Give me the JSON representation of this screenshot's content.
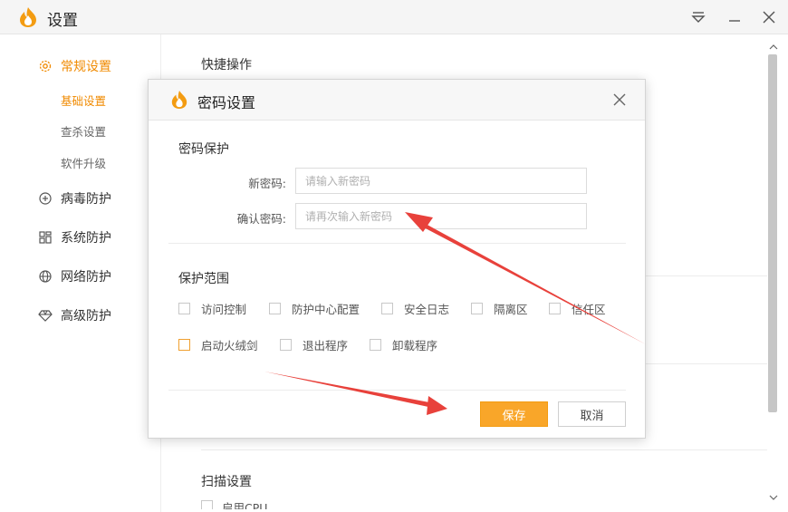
{
  "window": {
    "title": "设置"
  },
  "sidebar": {
    "items": [
      {
        "label": "常规设置",
        "icon": "gear-icon",
        "active": true
      },
      {
        "label": "病毒防护",
        "icon": "plus-circle-icon"
      },
      {
        "label": "系统防护",
        "icon": "windows-grid-icon"
      },
      {
        "label": "网络防护",
        "icon": "globe-icon"
      },
      {
        "label": "高级防护",
        "icon": "diamond-icon"
      }
    ],
    "sub_items": [
      {
        "label": "基础设置",
        "active": true
      },
      {
        "label": "查杀设置"
      },
      {
        "label": "软件升级"
      }
    ]
  },
  "content": {
    "quick_ops_title": "快捷操作",
    "scan_settings_title": "扫描设置",
    "scan_partial_text": "启用CPU..."
  },
  "dialog": {
    "title": "密码设置",
    "password_section": "密码保护",
    "new_password_label": "新密码:",
    "new_password_placeholder": "请输入新密码",
    "confirm_password_label": "确认密码:",
    "confirm_password_placeholder": "请再次输入新密码",
    "scope_section": "保护范围",
    "scope_options_row1": [
      "访问控制",
      "防护中心配置",
      "安全日志",
      "隔离区",
      "信任区"
    ],
    "scope_options_row2": [
      "启动火绒剑",
      "退出程序",
      "卸载程序"
    ],
    "save_label": "保存",
    "cancel_label": "取消"
  },
  "colors": {
    "accent": "#f08a00",
    "save_button": "#f9a629",
    "annotation_arrow": "#e8413b"
  }
}
